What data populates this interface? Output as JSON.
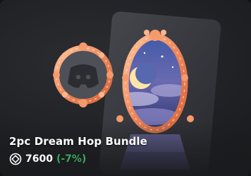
{
  "item": {
    "name": "2pc Dream Hop Bundle",
    "price": "7600",
    "discount": "(-7%)",
    "currency_icon": "orb-icon"
  },
  "colors": {
    "card_bg": "#1f2023",
    "title": "#ffffff",
    "price": "#ffffff",
    "discount": "#3ba55c",
    "frame": "#f08a5d",
    "sky": "#3a4a8c"
  }
}
